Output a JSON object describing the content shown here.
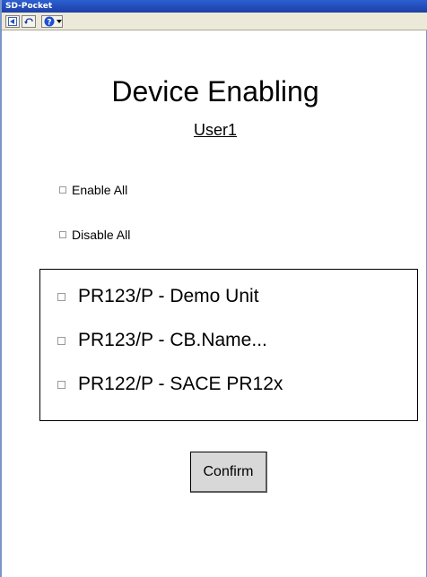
{
  "window": {
    "title": "SD-Pocket"
  },
  "toolbar": {
    "icons": [
      "back-icon",
      "undo-icon",
      "help-icon",
      "dropdown-arrow-icon"
    ]
  },
  "main": {
    "title": "Device Enabling",
    "user": "User1",
    "enable_all": "Enable All",
    "disable_all": "Disable All",
    "devices": [
      {
        "label": "PR123/P - Demo Unit"
      },
      {
        "label": "PR123/P - CB.Name..."
      },
      {
        "label": "PR122/P - SACE PR12x"
      }
    ],
    "confirm_label": "Confirm"
  },
  "colors": {
    "titlebar": "#1e3fa5",
    "toolbar": "#ece9d8",
    "button": "#d8d8d8"
  }
}
